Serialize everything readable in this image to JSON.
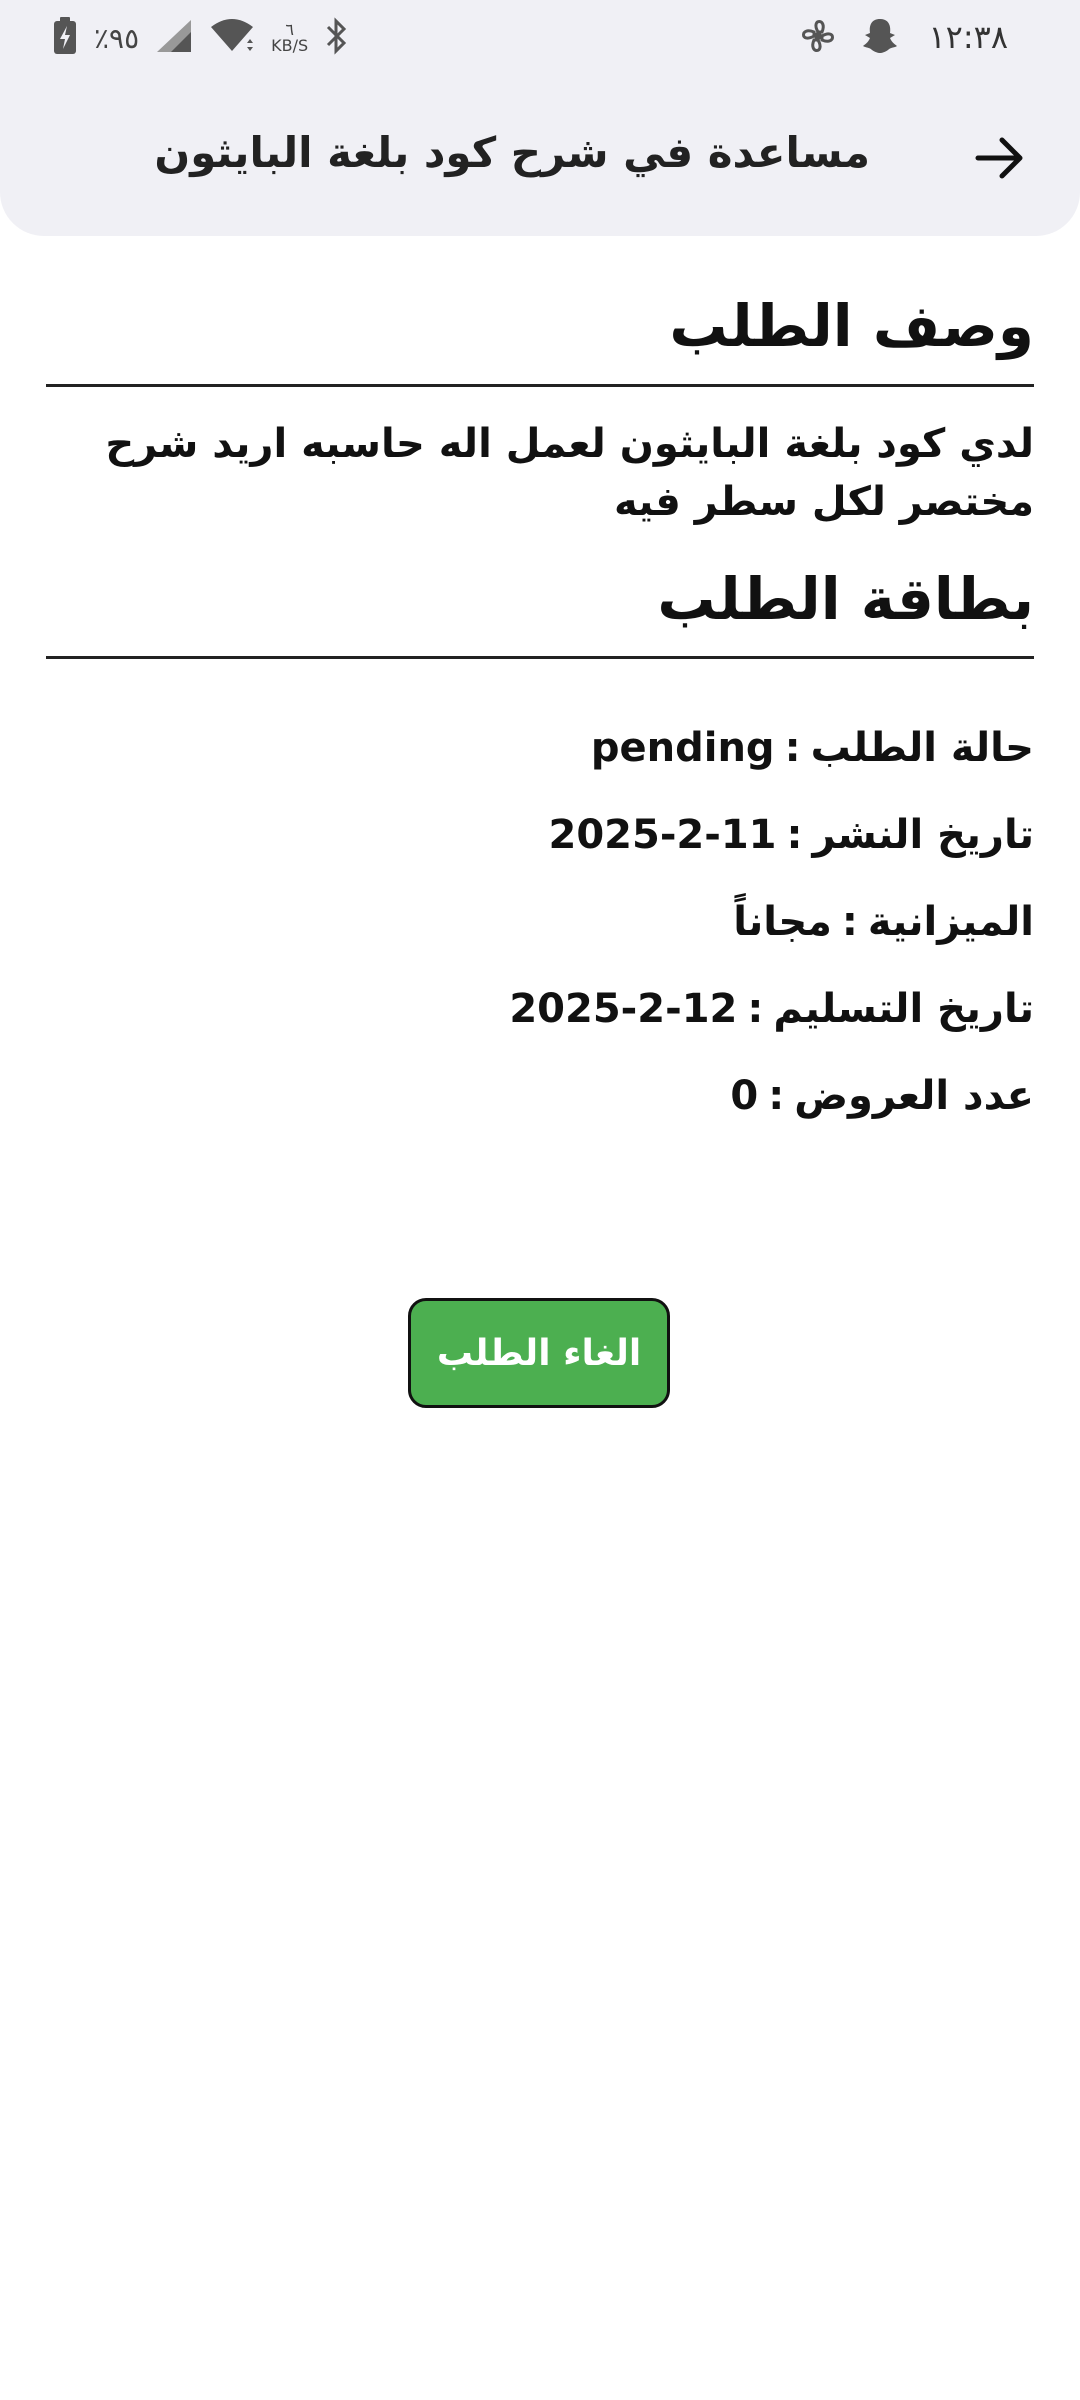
{
  "status_bar": {
    "time": "١٢:٣٨",
    "battery_percent": "٪٩٥",
    "net_speed_value": "٦",
    "net_speed_unit": "KB/S"
  },
  "app_bar": {
    "title": "مساعدة في شرح كود بلغة البايثون",
    "back_icon": "arrow-right-icon"
  },
  "description_section": {
    "title": "وصف الطلب",
    "text": "لدي كود بلغة البايثون لعمل اله حاسبه اريد شرح مختصر لكل سطر فيه"
  },
  "card_section": {
    "title": "بطاقة الطلب",
    "rows": [
      {
        "label": "حالة الطلب",
        "value": "pending"
      },
      {
        "label": "تاريخ النشر",
        "value": "2025-2-11"
      },
      {
        "label": "الميزانية",
        "value": "مجاناً"
      },
      {
        "label": "تاريخ التسليم",
        "value": "2025-2-12"
      },
      {
        "label": "عدد العروض",
        "value": "0"
      }
    ]
  },
  "actions": {
    "cancel_label": "الغاء الطلب"
  },
  "colors": {
    "accent": "#4caf50",
    "app_bar_bg": "#f0f0f5"
  }
}
